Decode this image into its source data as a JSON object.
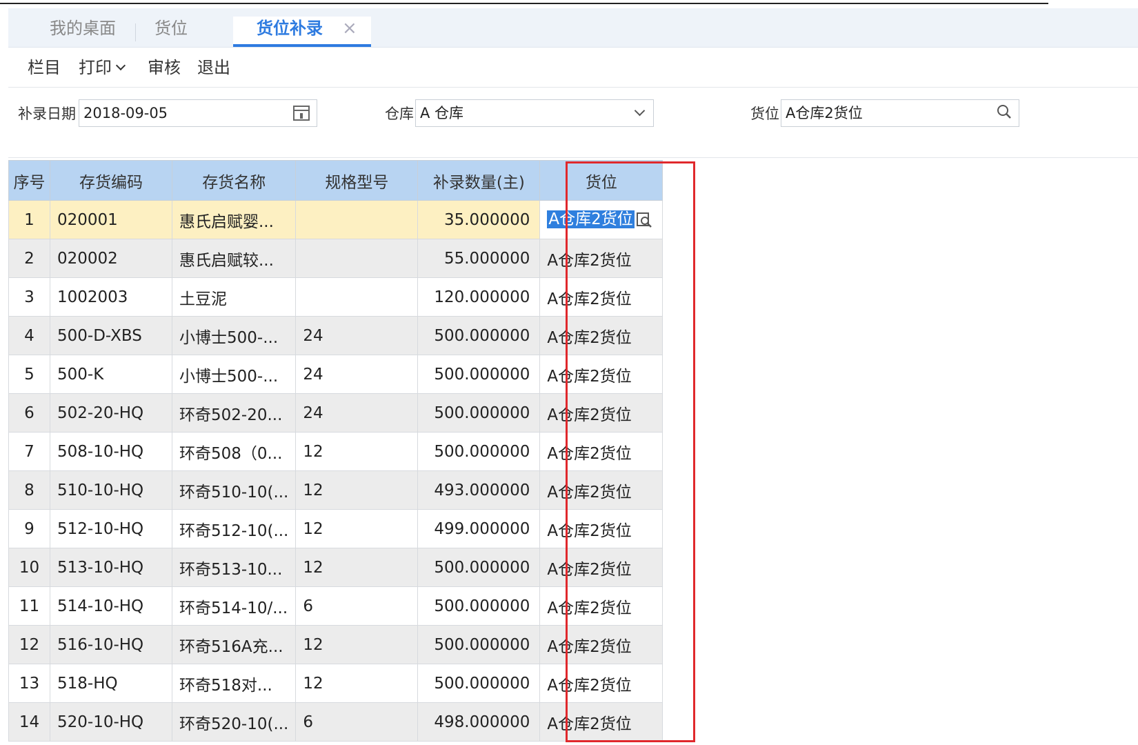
{
  "tabs": {
    "desktop": "我的桌面",
    "location": "货位",
    "active": "货位补录",
    "close_glyph": "×"
  },
  "toolbar": {
    "columns": "栏目",
    "print": "打印",
    "audit": "审核",
    "exit": "退出"
  },
  "filters": {
    "date_label": "补录日期",
    "date_value": "2018-09-05",
    "warehouse_label": "仓库",
    "warehouse_value": "A 仓库",
    "location_label": "货位",
    "location_value": "A仓库2货位"
  },
  "grid": {
    "columns": [
      "序号",
      "存货编码",
      "存货名称",
      "规格型号",
      "补录数量(主)",
      "货位"
    ],
    "rows": [
      {
        "no": "1",
        "code": "020001",
        "name": "惠氏启赋婴...",
        "spec": "",
        "qty": "35.000000",
        "loc": "A仓库2货位"
      },
      {
        "no": "2",
        "code": "020002",
        "name": "惠氏启赋较...",
        "spec": "",
        "qty": "55.000000",
        "loc": "A仓库2货位"
      },
      {
        "no": "3",
        "code": "1002003",
        "name": "土豆泥",
        "spec": "",
        "qty": "120.000000",
        "loc": "A仓库2货位"
      },
      {
        "no": "4",
        "code": "500-D-XBS",
        "name": "小博士500-...",
        "spec": "24",
        "qty": "500.000000",
        "loc": "A仓库2货位"
      },
      {
        "no": "5",
        "code": "500-K",
        "name": "小博士500-...",
        "spec": "24",
        "qty": "500.000000",
        "loc": "A仓库2货位"
      },
      {
        "no": "6",
        "code": "502-20-HQ",
        "name": "环奇502-20...",
        "spec": "24",
        "qty": "500.000000",
        "loc": "A仓库2货位"
      },
      {
        "no": "7",
        "code": "508-10-HQ",
        "name": "环奇508（0...",
        "spec": "12",
        "qty": "500.000000",
        "loc": "A仓库2货位"
      },
      {
        "no": "8",
        "code": "510-10-HQ",
        "name": "环奇510-10(...",
        "spec": "12",
        "qty": "493.000000",
        "loc": "A仓库2货位"
      },
      {
        "no": "9",
        "code": "512-10-HQ",
        "name": "环奇512-10(...",
        "spec": "12",
        "qty": "499.000000",
        "loc": "A仓库2货位"
      },
      {
        "no": "10",
        "code": "513-10-HQ",
        "name": "环奇513-10...",
        "spec": "12",
        "qty": "500.000000",
        "loc": "A仓库2货位"
      },
      {
        "no": "11",
        "code": "514-10-HQ",
        "name": "环奇514-10/...",
        "spec": "6",
        "qty": "500.000000",
        "loc": "A仓库2货位"
      },
      {
        "no": "12",
        "code": "516-10-HQ",
        "name": "环奇516A充...",
        "spec": "12",
        "qty": "500.000000",
        "loc": "A仓库2货位"
      },
      {
        "no": "13",
        "code": "518-HQ",
        "name": "环奇518对...",
        "spec": "12",
        "qty": "500.000000",
        "loc": "A仓库2货位"
      },
      {
        "no": "14",
        "code": "520-10-HQ",
        "name": "环奇520-10(...",
        "spec": "6",
        "qty": "498.000000",
        "loc": "A仓库2货位"
      }
    ]
  },
  "colors": {
    "accent": "#2e7be0",
    "header_bg": "#b8d4f2",
    "selected_row": "#fdf0c2",
    "highlight_border": "#e0282c"
  }
}
